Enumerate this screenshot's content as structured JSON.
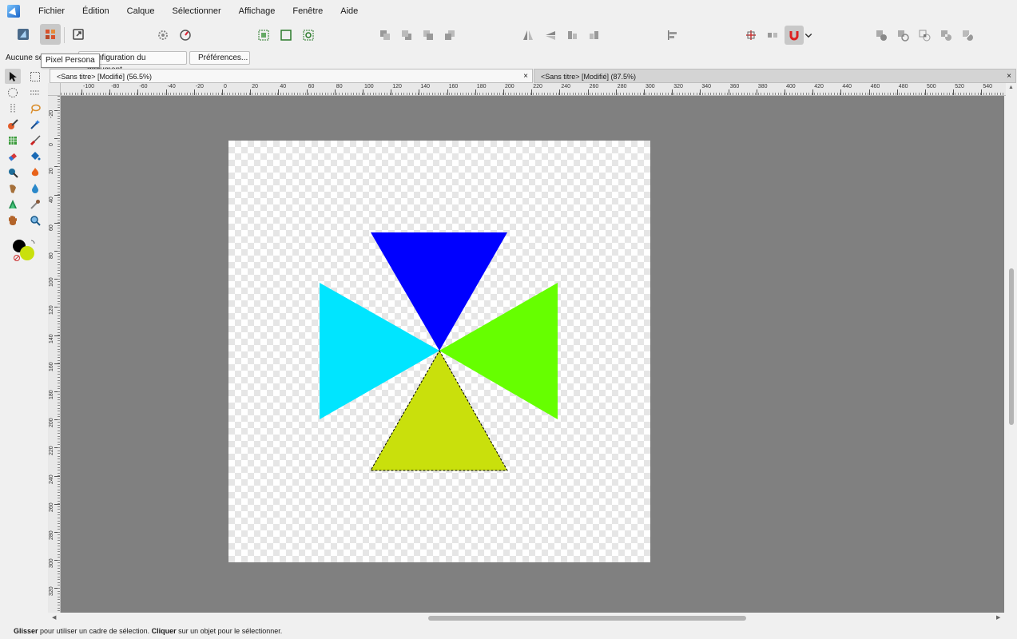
{
  "menu": [
    "Fichier",
    "Édition",
    "Calque",
    "Sélectionner",
    "Affichage",
    "Fenêtre",
    "Aide"
  ],
  "tooltip": "Pixel Persona",
  "context": {
    "no_selection": "Aucune sél",
    "doc_setup_label": "Configuration du document...",
    "prefs_label": "Préférences..."
  },
  "tabs": [
    {
      "title": "<Sans titre> [Modifié] (56.5%)",
      "close": "×"
    },
    {
      "title": "<Sans titre> [Modifié] (87.5%)",
      "close": "×"
    }
  ],
  "ruler": {
    "h_labels": [
      "-100",
      "-80",
      "-60",
      "-40",
      "-20",
      "0",
      "20",
      "40",
      "60",
      "80",
      "100",
      "120",
      "140",
      "160",
      "180",
      "200",
      "220",
      "240",
      "260",
      "280",
      "300",
      "320",
      "340",
      "360",
      "380",
      "400",
      "420",
      "440",
      "460",
      "480",
      "500",
      "520",
      "540"
    ],
    "v_labels": [
      "-20",
      "0",
      "20",
      "40",
      "60",
      "80",
      "100",
      "120",
      "140",
      "160",
      "180",
      "200",
      "220",
      "240",
      "260",
      "280",
      "300",
      "320"
    ]
  },
  "canvas": {
    "triangle_colors": {
      "top": "#0000ff",
      "left": "#00e5ff",
      "right": "#66ff00",
      "bottom": "#c9e00c"
    },
    "background": "#808080"
  },
  "colors": {
    "primary": "#000000",
    "secondary": "#c9e00c"
  },
  "status": {
    "drag": "Glisser",
    "drag_rest": " pour utiliser un cadre de sélection. ",
    "click": "Cliquer",
    "click_rest": " sur un objet pour le sélectionner."
  }
}
